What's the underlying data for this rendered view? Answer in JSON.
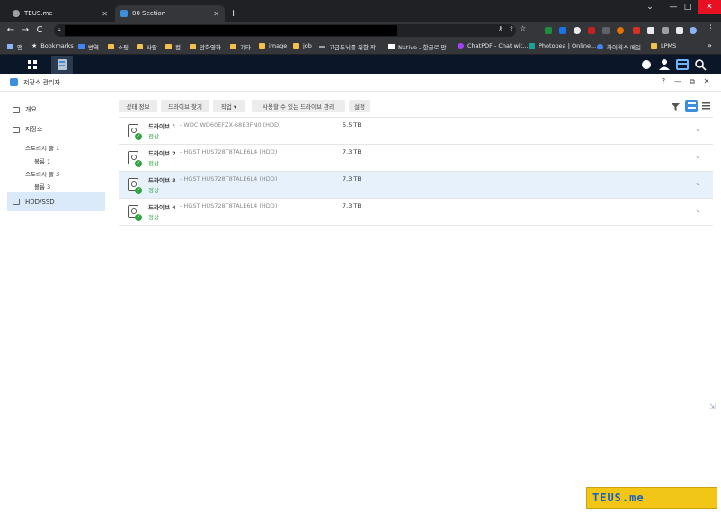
{
  "browser": {
    "tabs": [
      {
        "title": "TEUS.me",
        "close": "✕"
      },
      {
        "title": "00 Section",
        "close": "✕"
      }
    ],
    "new_tab": "+",
    "window_controls": {
      "min": "⌄",
      "minimize": "—",
      "restore": "□",
      "close": "✕"
    },
    "nav": {
      "back": "←",
      "forward": "→",
      "reload": "C"
    },
    "bookmarks": [
      {
        "label": "앱",
        "icon": "apps-icon"
      },
      {
        "label": "Bookmarks",
        "icon": "star-icon"
      },
      {
        "label": "번역",
        "icon": "translate-icon"
      },
      {
        "label": "쇼핑",
        "icon": "folder-icon"
      },
      {
        "label": "사람",
        "icon": "folder-icon"
      },
      {
        "label": "컴",
        "icon": "folder-icon"
      },
      {
        "label": "만화영화",
        "icon": "folder-icon"
      },
      {
        "label": "기타",
        "icon": "folder-icon"
      },
      {
        "label": "image",
        "icon": "folder-icon"
      },
      {
        "label": "job",
        "icon": "folder-icon"
      },
      {
        "label": "고급두뇌를 위한 작...",
        "icon": "site-icon"
      },
      {
        "label": "Native - 한글로 만...",
        "icon": "notion-icon"
      },
      {
        "label": "ChatPDF - Chat wit...",
        "icon": "chatpdf-icon"
      },
      {
        "label": "Photopea | Online...",
        "icon": "photopea-icon"
      },
      {
        "label": "하이웍스 메일",
        "icon": "hiworks-icon"
      },
      {
        "label": "LPMS",
        "icon": "folder-icon"
      }
    ],
    "bookmarks_more": "»"
  },
  "app": {
    "title": "저장소 관리자",
    "controls": {
      "help": "?",
      "minimize": "—",
      "restore": "⧉",
      "close": "✕"
    }
  },
  "sidebar": {
    "overview": "개요",
    "storage": "저장소",
    "pools": [
      {
        "label": "스토리지 풀 1",
        "volume": "볼륨 1"
      },
      {
        "label": "스토리지 풀 3",
        "volume": "볼륨 3"
      }
    ],
    "hdd": "HDD/SSD"
  },
  "toolbar": {
    "status": "상태 정보",
    "find": "드라이브 찾기",
    "action": "작업 ▾",
    "manage_available": "사용할 수 있는 드라이브 관리",
    "settings": "설정"
  },
  "drives": [
    {
      "name": "드라이브 1",
      "model": "- WDC WD60EFZX-68B3FN0 (HDD)",
      "status": "정상",
      "size": "5.5 TB"
    },
    {
      "name": "드라이브 2",
      "model": "- HGST HUS728T8TALE6L4 (HDD)",
      "status": "정상",
      "size": "7.3 TB"
    },
    {
      "name": "드라이브 3",
      "model": "- HGST HUS728T8TALE6L4 (HDD)",
      "status": "정상",
      "size": "7.3 TB"
    },
    {
      "name": "드라이브 4",
      "model": "- HGST HUS728T8TALE6L4 (HDD)",
      "status": "정상",
      "size": "7.3 TB"
    }
  ],
  "watermark": "TEUS.me",
  "colors": {
    "accent": "#3d8fdb",
    "ok": "#2fa33f",
    "selected_row": "#e6f1fc"
  }
}
